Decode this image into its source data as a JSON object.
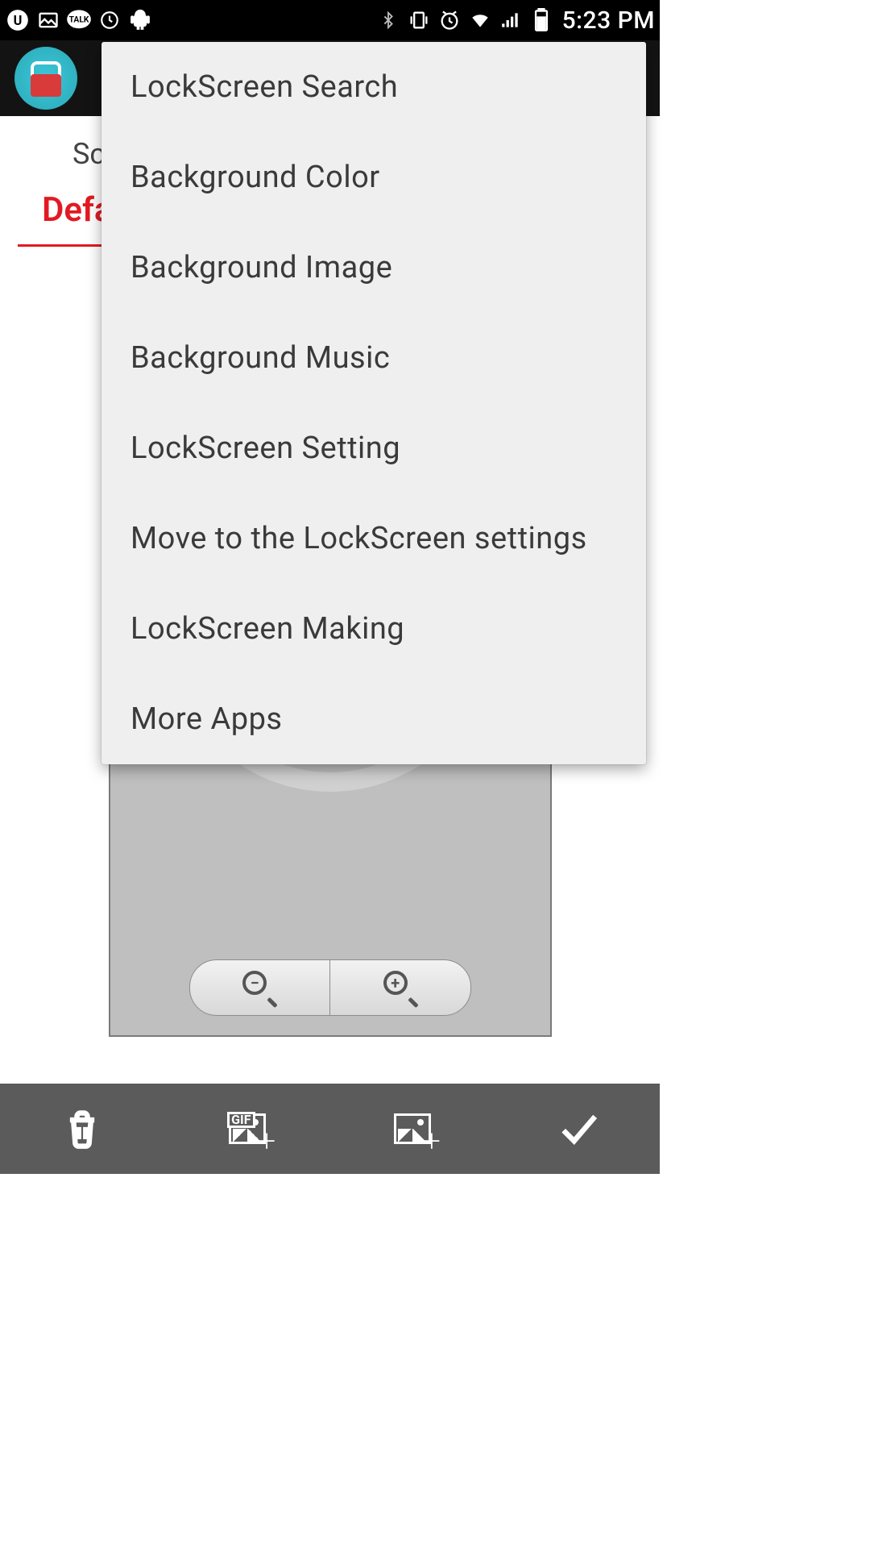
{
  "status": {
    "time": "5:23 PM"
  },
  "page": {
    "row_label": "Sc",
    "active_tab": "Defa"
  },
  "zoom": {
    "minus": "−",
    "plus": "+"
  },
  "bottom": {
    "gif": "GIF"
  },
  "menu": {
    "items": [
      "LockScreen Search",
      "Background Color",
      "Background Image",
      "Background Music",
      "LockScreen Setting",
      "Move to the LockScreen settings",
      "LockScreen Making",
      "More Apps"
    ]
  }
}
